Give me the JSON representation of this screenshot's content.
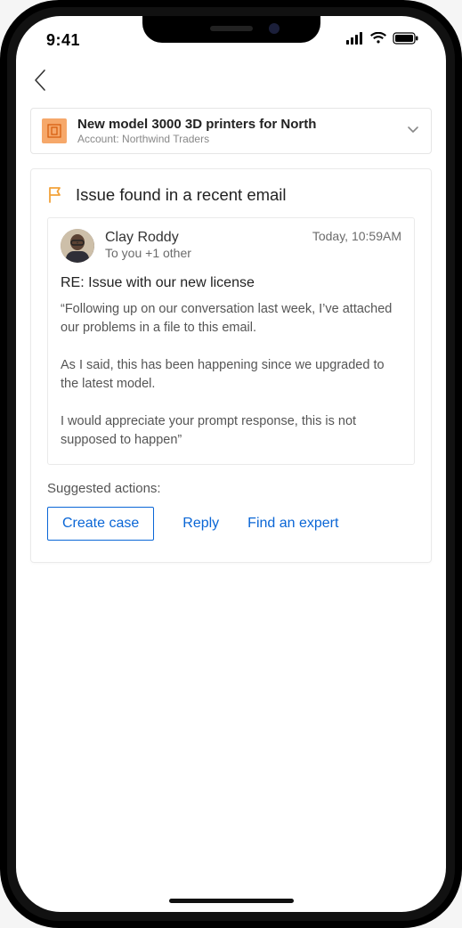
{
  "status_bar": {
    "time": "9:41"
  },
  "context": {
    "title": "New model 3000 3D printers for North",
    "subtitle_prefix": "Account:",
    "subtitle_value": "Northwind Traders"
  },
  "issue": {
    "header": "Issue found in a recent email",
    "sender": "Clay Roddy",
    "recipients": "To you +1 other",
    "time": "Today, 10:59AM",
    "subject": "RE: Issue with our new license",
    "body": "“Following up on our conversation last week, I’ve attached our problems in a file to this email.\n\nAs I said, this has been happening since we upgraded to the latest model.\n\nI would appreciate your prompt response, this is not supposed to happen”"
  },
  "actions": {
    "label": "Suggested actions:",
    "primary": "Create case",
    "secondary1": "Reply",
    "secondary2": "Find an expert"
  }
}
